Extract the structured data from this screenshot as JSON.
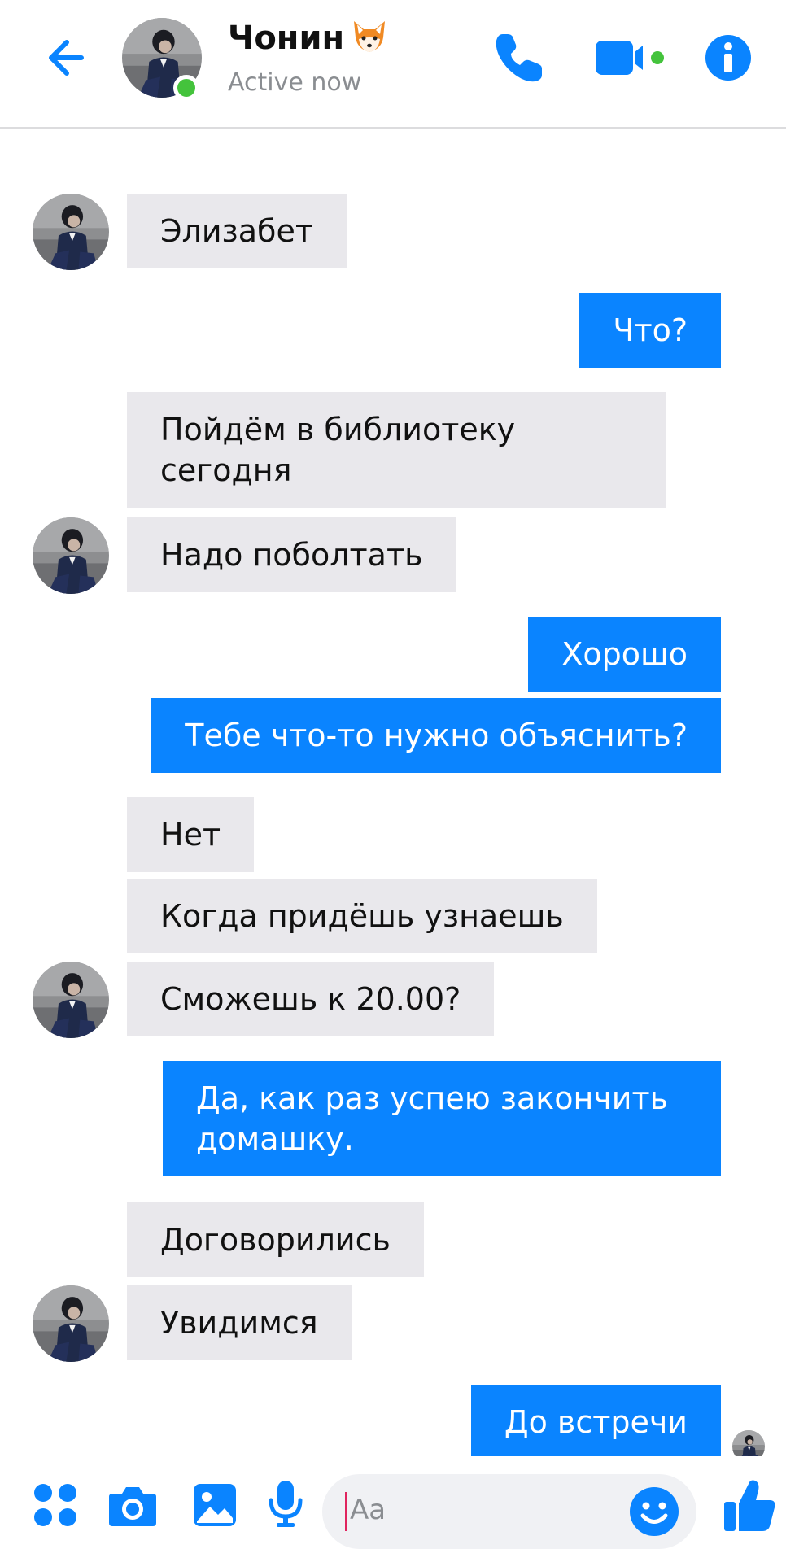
{
  "header": {
    "name": "Чонин",
    "status": "Active now"
  },
  "messages": [
    {
      "side": "in",
      "text": "Элизабет"
    },
    {
      "side": "out",
      "text": "Что?"
    },
    {
      "side": "in",
      "text": "Пойдём в библиотеку сегодня"
    },
    {
      "side": "in",
      "text": "Надо поболтать"
    },
    {
      "side": "out",
      "text": "Хорошо"
    },
    {
      "side": "out",
      "text": "Тебе что-то нужно объяснить?"
    },
    {
      "side": "in",
      "text": "Нет"
    },
    {
      "side": "in",
      "text": "Когда придёшь узнаешь"
    },
    {
      "side": "in",
      "text": "Сможешь к 20.00?"
    },
    {
      "side": "out",
      "text": "Да, как раз успею закончить домашку."
    },
    {
      "side": "in",
      "text": "Договорились"
    },
    {
      "side": "in",
      "text": "Увидимся"
    },
    {
      "side": "out",
      "text": "До встречи"
    }
  ],
  "composer": {
    "placeholder": "Aa"
  },
  "colors": {
    "accent": "#0a84ff",
    "incoming_bubble": "#e9e8ec",
    "online": "#44c33c"
  },
  "icons": [
    "back-arrow-icon",
    "phone-icon",
    "video-camera-icon",
    "info-icon",
    "apps-icon",
    "camera-icon",
    "image-icon",
    "microphone-icon",
    "smile-icon",
    "thumbs-up-icon",
    "fox-emoji"
  ]
}
